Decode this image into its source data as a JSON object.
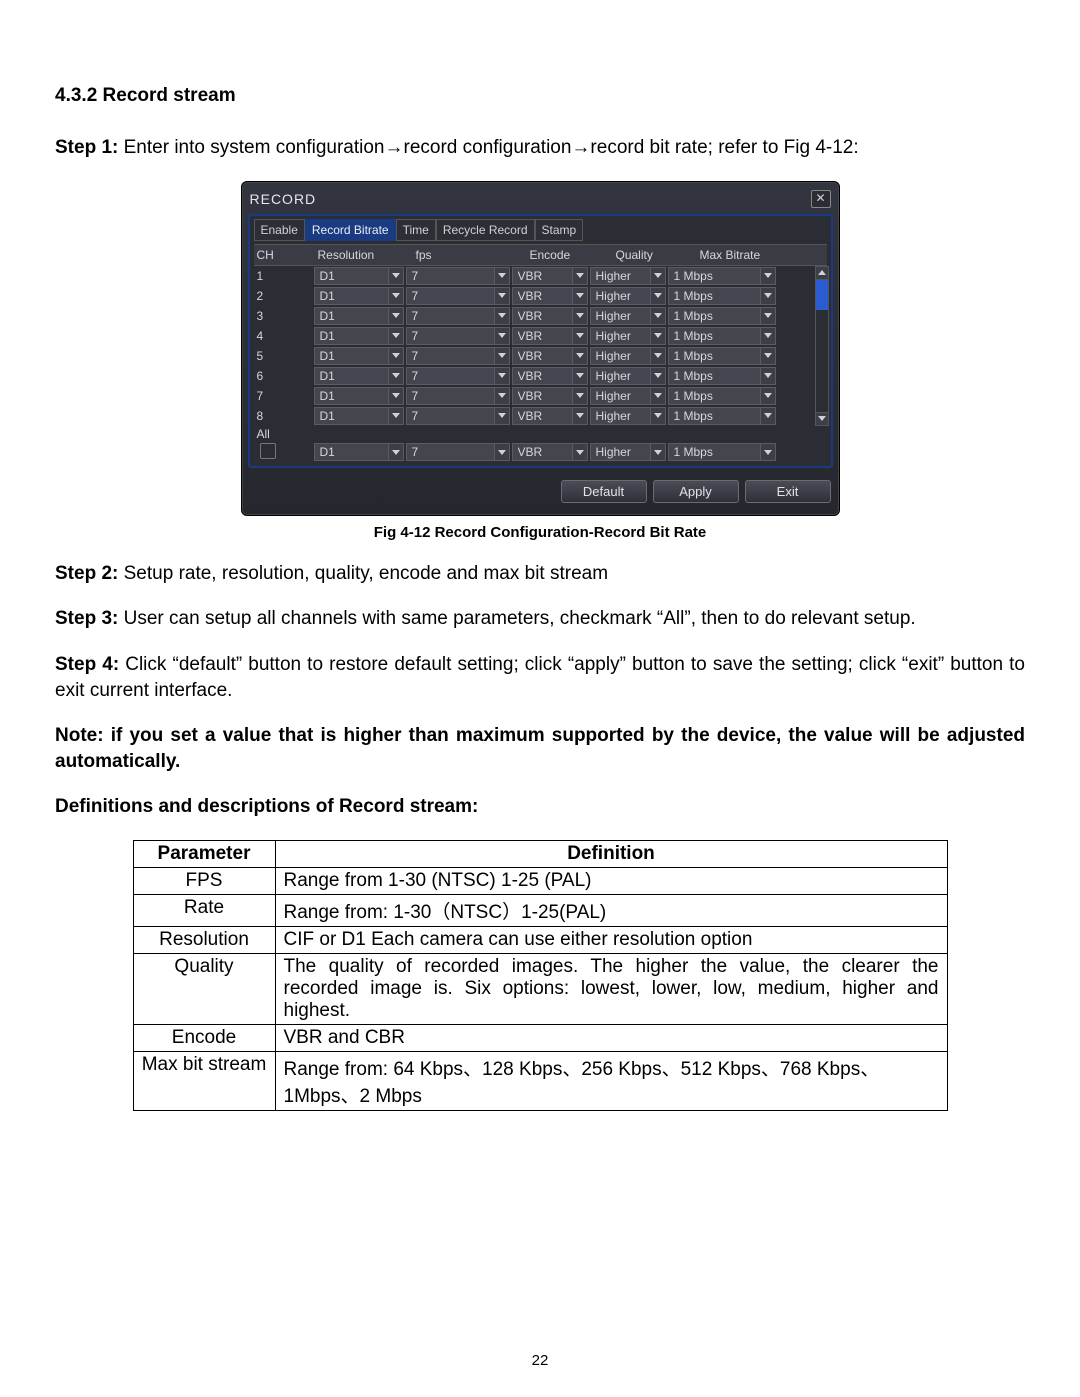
{
  "section_heading": "4.3.2 Record stream",
  "step1": {
    "label": "Step 1:",
    "text": " Enter into system configuration→record configuration→record bit rate; refer to Fig 4-12:"
  },
  "step2": {
    "label": "Step 2:",
    "text": " Setup rate, resolution, quality, encode and max bit stream"
  },
  "step3": {
    "label": "Step 3:",
    "text": " User can setup all channels with same parameters, checkmark “All”, then to do relevant setup."
  },
  "step4": {
    "label": "Step 4:",
    "text": " Click “default” button to restore default setting; click “apply” button to save the setting; click “exit” button to exit current interface."
  },
  "note": "Note: if you set a value that is higher than maximum supported by the device, the value will be adjusted automatically.",
  "def_heading": "Definitions and descriptions of Record stream:",
  "fig_caption": "Fig 4-12 Record Configuration-Record Bit Rate",
  "page_number": "22",
  "dvr": {
    "title": "RECORD",
    "tabs": [
      "Enable",
      "Record Bitrate",
      "Time",
      "Recycle Record",
      "Stamp"
    ],
    "active_tab_index": 1,
    "columns": {
      "ch": "CH",
      "res": "Resolution",
      "fps": "fps",
      "enc": "Encode",
      "qual": "Quality",
      "max": "Max Bitrate"
    },
    "rows": [
      {
        "ch": "1",
        "res": "D1",
        "fps": "7",
        "enc": "VBR",
        "qual": "Higher",
        "max": "1 Mbps"
      },
      {
        "ch": "2",
        "res": "D1",
        "fps": "7",
        "enc": "VBR",
        "qual": "Higher",
        "max": "1 Mbps"
      },
      {
        "ch": "3",
        "res": "D1",
        "fps": "7",
        "enc": "VBR",
        "qual": "Higher",
        "max": "1 Mbps"
      },
      {
        "ch": "4",
        "res": "D1",
        "fps": "7",
        "enc": "VBR",
        "qual": "Higher",
        "max": "1 Mbps"
      },
      {
        "ch": "5",
        "res": "D1",
        "fps": "7",
        "enc": "VBR",
        "qual": "Higher",
        "max": "1 Mbps"
      },
      {
        "ch": "6",
        "res": "D1",
        "fps": "7",
        "enc": "VBR",
        "qual": "Higher",
        "max": "1 Mbps"
      },
      {
        "ch": "7",
        "res": "D1",
        "fps": "7",
        "enc": "VBR",
        "qual": "Higher",
        "max": "1 Mbps"
      },
      {
        "ch": "8",
        "res": "D1",
        "fps": "7",
        "enc": "VBR",
        "qual": "Higher",
        "max": "1 Mbps"
      }
    ],
    "all_row": {
      "label": "All",
      "res": "D1",
      "fps": "7",
      "enc": "VBR",
      "qual": "Higher",
      "max": "1 Mbps"
    },
    "buttons": {
      "default": "Default",
      "apply": "Apply",
      "exit": "Exit"
    }
  },
  "def_table": {
    "head": {
      "param": "Parameter",
      "defn": "Definition"
    },
    "rows": [
      {
        "param": "FPS",
        "defn": "Range from 1-30 (NTSC) 1-25 (PAL)"
      },
      {
        "param": "Rate",
        "defn": "Range from: 1-30（NTSC）1-25(PAL)"
      },
      {
        "param": "Resolution",
        "defn": "CIF or D1 Each camera can use either resolution option"
      },
      {
        "param": "Quality",
        "defn": "The quality of recorded images. The higher the value, the clearer the recorded image is. Six options: lowest, lower, low, medium, higher and highest.",
        "justify": true
      },
      {
        "param": "Encode",
        "defn": "VBR and CBR"
      },
      {
        "param": "Max bit stream",
        "defn": "Range from: 64 Kbps、128 Kbps、256 Kbps、512 Kbps、768 Kbps、1Mbps、2 Mbps"
      }
    ]
  }
}
